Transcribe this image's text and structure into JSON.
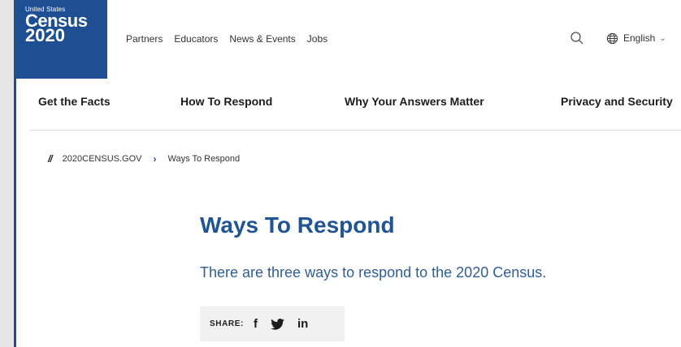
{
  "logo": {
    "top_line": "United States",
    "word": "Census",
    "year": "2020"
  },
  "utility_nav": [
    "Partners",
    "Educators",
    "News & Events",
    "Jobs"
  ],
  "header": {
    "search_icon": "search-icon",
    "language_icon": "globe-icon",
    "language": "English"
  },
  "main_nav": [
    "Get the Facts",
    "How To Respond",
    "Why Your Answers Matter",
    "Privacy and Security"
  ],
  "breadcrumb": {
    "root": "2020CENSUS.GOV",
    "current": "Ways To Respond"
  },
  "page": {
    "title": "Ways To Respond",
    "intro": "There are three ways to respond to the 2020 Census."
  },
  "share": {
    "label": "SHARE:",
    "facebook": "f",
    "twitter_icon": "twitter-icon",
    "linkedin": "in"
  },
  "colors": {
    "brand_blue": "#1f4f93",
    "title_blue": "#205493",
    "share_bg": "#f1f1f1"
  }
}
